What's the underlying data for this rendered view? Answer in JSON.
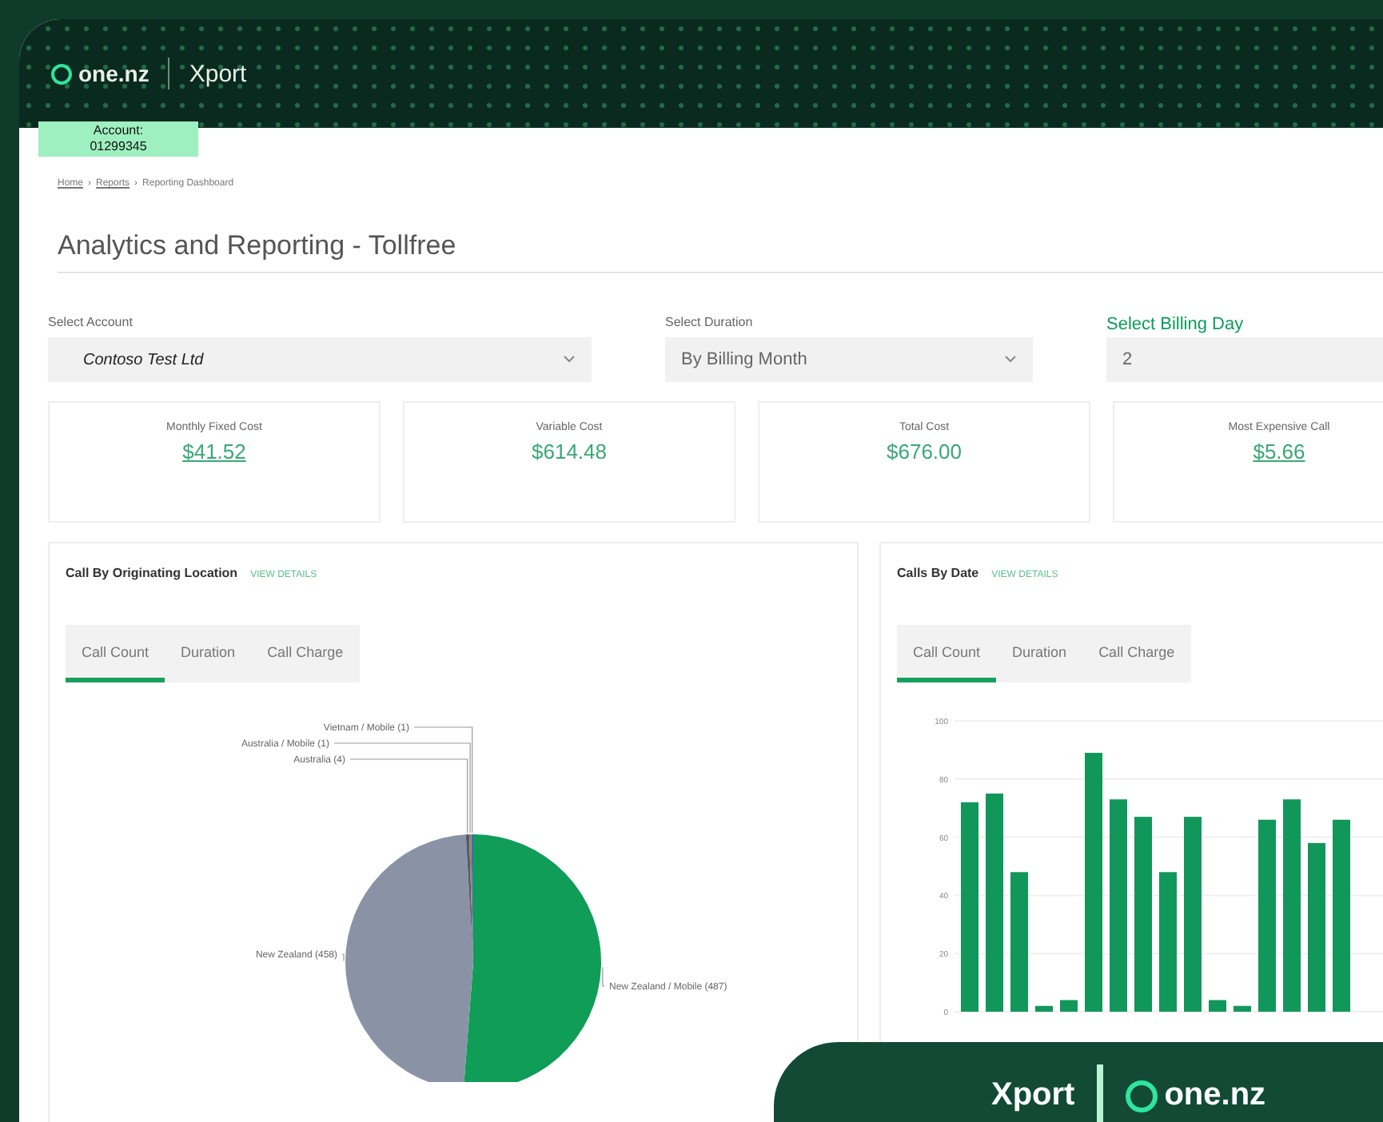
{
  "header": {
    "brand": "one.nz",
    "product": "Xport"
  },
  "account": {
    "label": "Account:",
    "number": "01299345"
  },
  "breadcrumb": {
    "separator": "›",
    "items": [
      "Home",
      "Reports",
      "Reporting Dashboard"
    ]
  },
  "page_title": "Analytics and Reporting - Tollfree",
  "filters": [
    {
      "label": "Select Account",
      "value": "Contoso Test Ltd",
      "kind": "dropdown",
      "highlight": false
    },
    {
      "label": "Select Duration",
      "value": "By Billing Month",
      "kind": "dropdown",
      "highlight": false
    },
    {
      "label": "Select Billing Day",
      "value": "2",
      "kind": "input",
      "highlight": true
    }
  ],
  "summary_cards": [
    {
      "label": "Monthly Fixed Cost",
      "value": "$41.52",
      "link": true
    },
    {
      "label": "Variable Cost",
      "value": "$614.48",
      "link": false
    },
    {
      "label": "Total Cost",
      "value": "$676.00",
      "link": false
    },
    {
      "label": "Most Expensive Call",
      "value": "$5.66",
      "link": true
    }
  ],
  "panels": [
    {
      "title": "Call By Originating Location",
      "link": "VIEW DETAILS",
      "tabs": [
        {
          "label": "Call Count",
          "selected": true
        },
        {
          "label": "Duration",
          "selected": false
        },
        {
          "label": "Call Charge",
          "selected": false
        }
      ],
      "chart_data": {
        "type": "pie",
        "categories": [
          "New Zealand / Mobile (487)",
          "New Zealand (458)",
          "Australia (4)",
          "Australia / Mobile (1)",
          "Vietnam / Mobile (1)"
        ],
        "values": [
          487,
          458,
          4,
          1,
          1
        ]
      }
    },
    {
      "title": "Calls By Date",
      "link": "VIEW DETAILS",
      "tabs": [
        {
          "label": "Call Count",
          "selected": true
        },
        {
          "label": "Duration",
          "selected": false
        },
        {
          "label": "Call Charge",
          "selected": false
        }
      ],
      "chart_data": {
        "type": "bar",
        "ylim": [
          0,
          100
        ],
        "yticks": [
          0,
          20,
          40,
          60,
          80,
          100
        ],
        "grid": true,
        "series": [
          {
            "color": "#12975a",
            "values": [
              72,
              75,
              48,
              2,
              4,
              89,
              73,
              67,
              48,
              67,
              4,
              2,
              66,
              73,
              58,
              66
            ]
          }
        ]
      }
    }
  ],
  "badge": {
    "product": "Xport",
    "brand": "one.nz"
  }
}
